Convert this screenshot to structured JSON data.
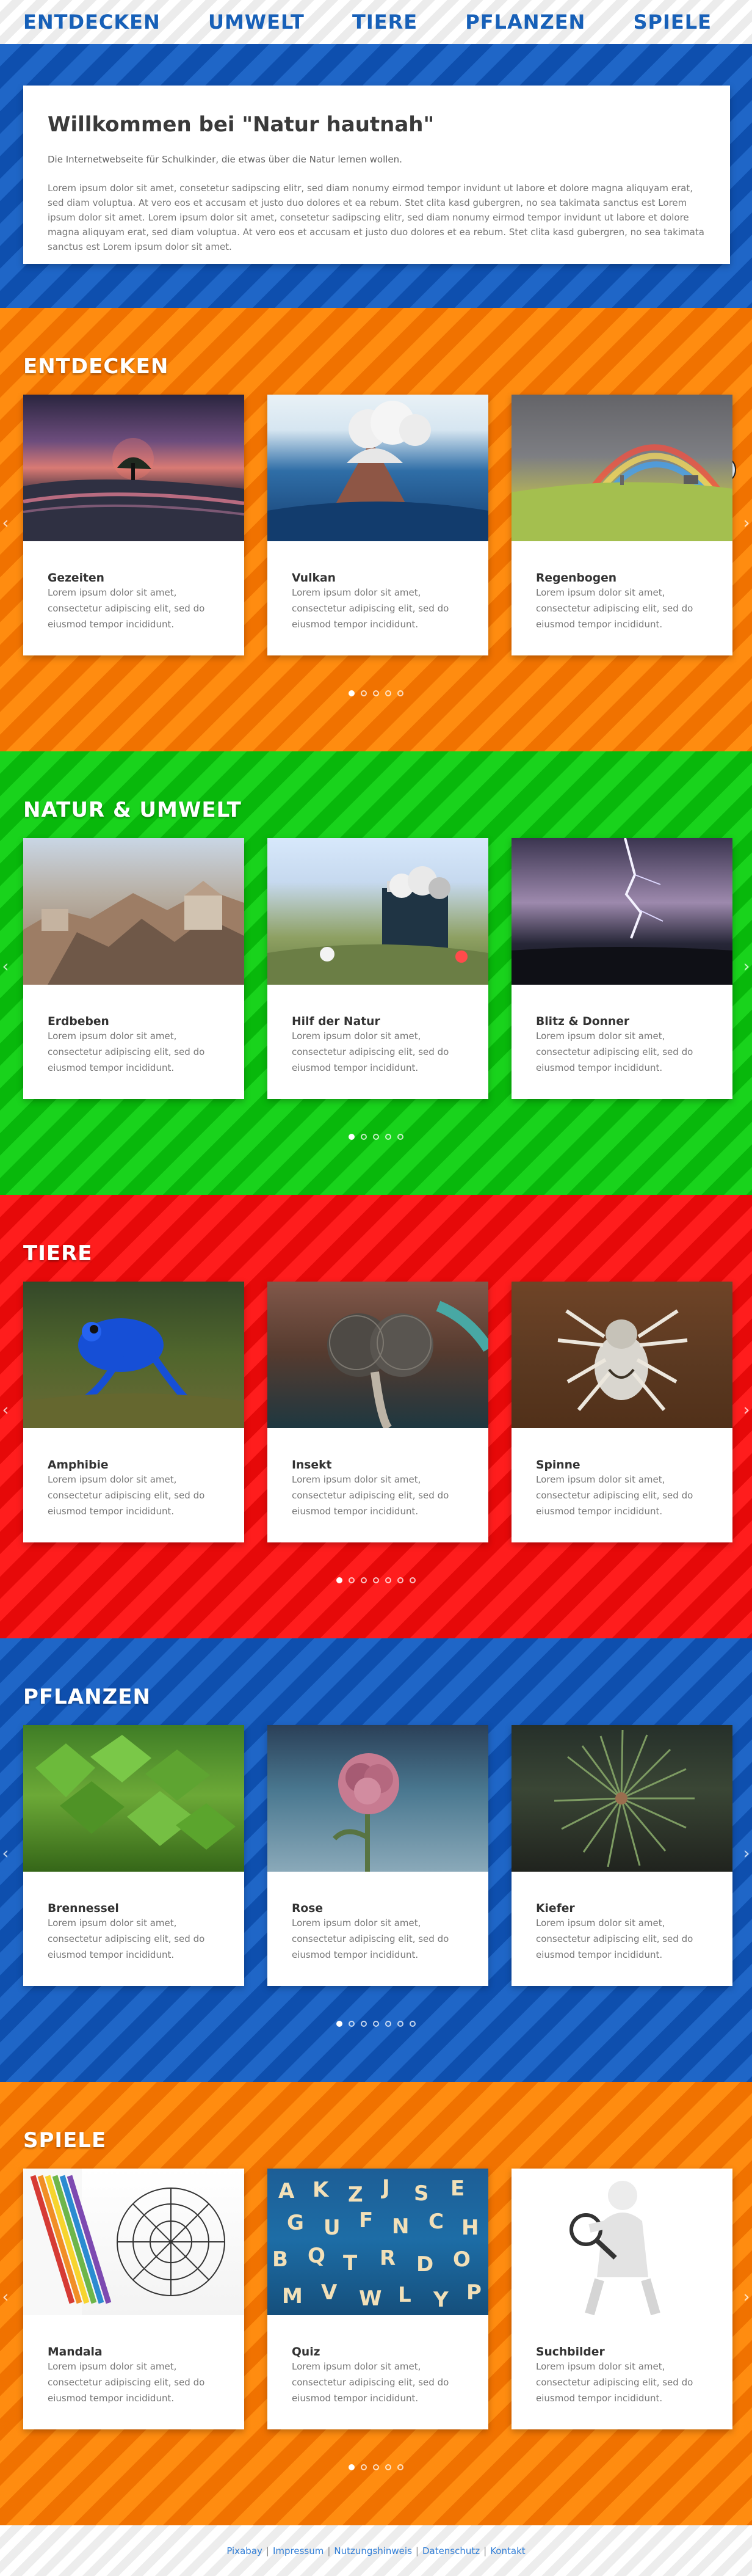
{
  "nav": {
    "items": [
      {
        "label": "ENTDECKEN"
      },
      {
        "label": "UMWELT"
      },
      {
        "label": "TIERE"
      },
      {
        "label": "PFLANZEN"
      },
      {
        "label": "SPIELE"
      }
    ]
  },
  "welcome": {
    "title": "Willkommen bei \"Natur hautnah\"",
    "intro": "Die Internetwebseite für Schulkinder, die etwas über die Natur lernen wollen.",
    "text": "Lorem ipsum dolor sit amet, consetetur sadipscing elitr, sed diam nonumy eirmod tempor invidunt ut labore et dolore magna aliquyam erat, sed diam voluptua. At vero eos et accusam et justo duo dolores et ea rebum. Stet clita kasd gubergren, no sea takimata sanctus est Lorem ipsum dolor sit amet. Lorem ipsum dolor sit amet, consetetur sadipscing elitr, sed diam nonumy eirmod tempor invidunt ut labore et dolore magna aliquyam erat, sed diam voluptua. At vero eos et accusam et justo duo dolores et ea rebum. Stet clita kasd gubergren, no sea takimata sanctus est Lorem ipsum dolor sit amet."
  },
  "sections": [
    {
      "title": "ENTDECKEN",
      "cards": [
        {
          "title": "Gezeiten",
          "text": "Lorem ipsum dolor sit amet, consectetur adipiscing elit, sed do eiusmod tempor incididunt."
        },
        {
          "title": "Vulkan",
          "text": "Lorem ipsum dolor sit amet, consectetur adipiscing elit, sed do eiusmod tempor incididunt."
        },
        {
          "title": "Regenbogen",
          "text": "Lorem ipsum dolor sit amet, consectetur adipiscing elit, sed do eiusmod tempor incididunt."
        }
      ]
    },
    {
      "title": "NATUR & UMWELT",
      "cards": [
        {
          "title": "Erdbeben",
          "text": "Lorem ipsum dolor sit amet, consectetur adipiscing elit, sed do eiusmod tempor incididunt."
        },
        {
          "title": "Hilf der Natur",
          "text": "Lorem ipsum dolor sit amet, consectetur adipiscing elit, sed do eiusmod tempor incididunt."
        },
        {
          "title": "Blitz & Donner",
          "text": "Lorem ipsum dolor sit amet, consectetur adipiscing elit, sed do eiusmod tempor incididunt."
        }
      ]
    },
    {
      "title": "TIERE",
      "cards": [
        {
          "title": "Amphibie",
          "text": "Lorem ipsum dolor sit amet, consectetur adipiscing elit, sed do eiusmod tempor incididunt."
        },
        {
          "title": "Insekt",
          "text": "Lorem ipsum dolor sit amet, consectetur adipiscing elit, sed do eiusmod tempor incididunt."
        },
        {
          "title": "Spinne",
          "text": "Lorem ipsum dolor sit amet, consectetur adipiscing elit, sed do eiusmod tempor incididunt."
        }
      ]
    },
    {
      "title": "PFLANZEN",
      "cards": [
        {
          "title": "Brennessel",
          "text": "Lorem ipsum dolor sit amet, consectetur adipiscing elit, sed do eiusmod tempor incididunt."
        },
        {
          "title": "Rose",
          "text": "Lorem ipsum dolor sit amet, consectetur adipiscing elit, sed do eiusmod tempor incididunt."
        },
        {
          "title": "Kiefer",
          "text": "Lorem ipsum dolor sit amet, consectetur adipiscing elit, sed do eiusmod tempor incididunt."
        }
      ]
    },
    {
      "title": "SPIELE",
      "cards": [
        {
          "title": "Mandala",
          "text": "Lorem ipsum dolor sit amet, consectetur adipiscing elit, sed do eiusmod tempor incididunt."
        },
        {
          "title": "Quiz",
          "text": "Lorem ipsum dolor sit amet, consectetur adipiscing elit, sed do eiusmod tempor incididunt."
        },
        {
          "title": "Suchbilder",
          "text": "Lorem ipsum dolor sit amet, consectetur adipiscing elit, sed do eiusmod tempor incididunt."
        }
      ]
    }
  ],
  "slider": {
    "icons": {
      "left": "chevron-left-icon",
      "right": "chevron-right-icon"
    }
  },
  "footer": {
    "links": [
      "Pixabay",
      "Impressum",
      "Nutzungshinweis",
      "Datenschutz",
      "Kontakt"
    ],
    "separator": "|"
  },
  "colors": {
    "nav_text": "#1760b8",
    "blue": "#1f66c7",
    "orange": "#ff8c10",
    "green": "#19d31c",
    "red": "#ff1d1d",
    "link": "#2f7dd6"
  }
}
